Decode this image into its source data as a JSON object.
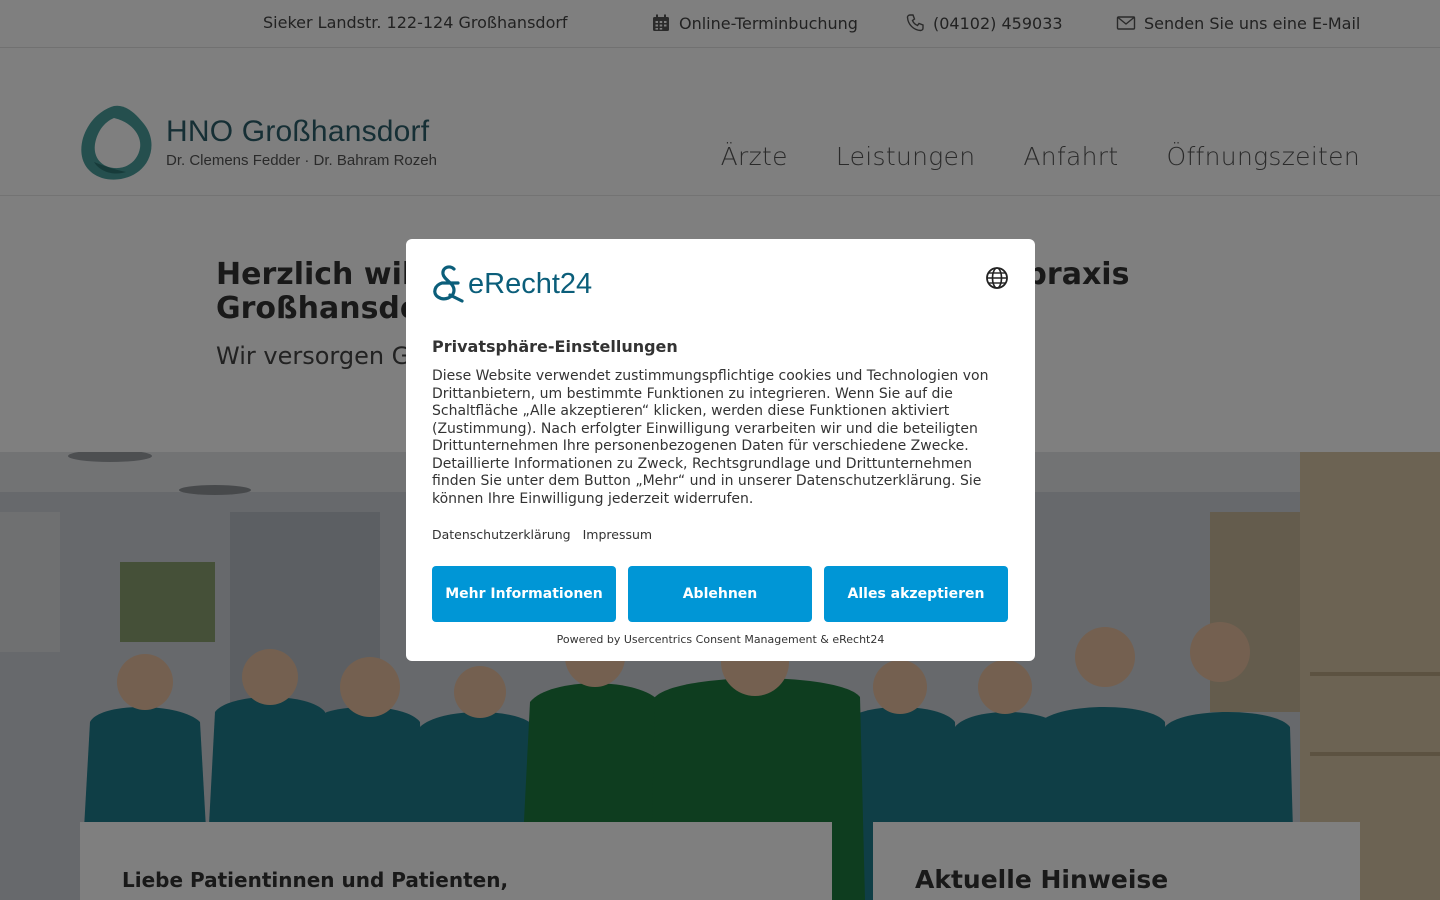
{
  "topbar": {
    "address": "Sieker Landstr. 122-124  Großhansdorf",
    "booking": "Online-Terminbuchung",
    "phone": "(04102) 459033",
    "email": "Senden Sie uns eine E-Mail"
  },
  "logo": {
    "title": "HNO Großhansdorf",
    "subtitle": "Dr. Clemens Fedder · Dr. Bahram Rozeh",
    "colors": {
      "mark": "#4a9e9c",
      "text": "#2c5f6b"
    }
  },
  "nav": [
    {
      "label": "Ärzte"
    },
    {
      "label": "Leistungen"
    },
    {
      "label": "Anfahrt"
    },
    {
      "label": "Öffnungszeiten"
    }
  ],
  "hero": {
    "heading": "Herzlich willkommen in der HNO-Gemeinschaftspraxis Großhansdorf",
    "subheading": "Wir versorgen Großhansdorf und Umgebung"
  },
  "cards": {
    "left_title": "Liebe Patientinnen und Patienten,",
    "right_title": "Aktuelle Hinweise"
  },
  "consent": {
    "brand": "eRecht24",
    "title": "Privatsphäre-Einstellungen",
    "description": "Diese Website verwendet zustimmungspflichtige cookies und Technologien von Drittanbietern, um bestimmte Funktionen zu integrieren. Wenn Sie auf die Schaltfläche „Alle akzeptieren“ klicken, werden diese Funktionen aktiviert (Zustimmung). Nach erfolgter Einwilligung verarbeiten wir und die beteiligten Drittunternehmen Ihre personenbezogenen Daten für verschiedene Zwecke. Detaillierte Informationen zu Zweck, Rechtsgrundlage und Drittunternehmen finden Sie unter dem Button „Mehr“ und in unserer Datenschutzerklärung. Sie können Ihre Einwilligung jederzeit widerrufen.",
    "link_privacy": "Datenschutzerklärung",
    "link_imprint": "Impressum",
    "btn_more": "Mehr Informationen",
    "btn_decline": "Ablehnen",
    "btn_accept": "Alles akzeptieren",
    "powered": "Powered by Usercentrics Consent Management & eRecht24",
    "colors": {
      "button": "#0096d6",
      "brand": "#0b5e7a"
    }
  }
}
